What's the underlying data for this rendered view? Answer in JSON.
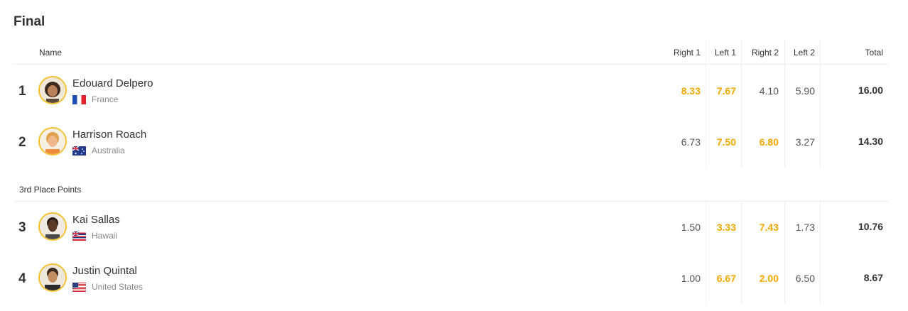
{
  "heat": {
    "title": "Final"
  },
  "columns": {
    "name": "Name",
    "right1": "Right 1",
    "left1": "Left 1",
    "right2": "Right 2",
    "left2": "Left 2",
    "total": "Total"
  },
  "section_label": "3rd Place Points",
  "highlight_color": "#f5a800",
  "surfers": [
    {
      "rank": "1",
      "name": "Edouard Delpero",
      "country": "France",
      "flag": "france-flag",
      "scores": [
        "8.33",
        "7.67",
        "4.10",
        "5.90"
      ],
      "highlighted": [
        true,
        true,
        false,
        false
      ],
      "total": "16.00"
    },
    {
      "rank": "2",
      "name": "Harrison Roach",
      "country": "Australia",
      "flag": "australia-flag",
      "scores": [
        "6.73",
        "7.50",
        "6.80",
        "3.27"
      ],
      "highlighted": [
        false,
        true,
        true,
        false
      ],
      "total": "14.30"
    },
    {
      "rank": "3",
      "name": "Kai Sallas",
      "country": "Hawaii",
      "flag": "hawaii-flag",
      "scores": [
        "1.50",
        "3.33",
        "7.43",
        "1.73"
      ],
      "highlighted": [
        false,
        true,
        true,
        false
      ],
      "total": "10.76"
    },
    {
      "rank": "4",
      "name": "Justin Quintal",
      "country": "United States",
      "flag": "usa-flag",
      "scores": [
        "1.00",
        "6.67",
        "2.00",
        "6.50"
      ],
      "highlighted": [
        false,
        true,
        true,
        false
      ],
      "total": "8.67"
    }
  ]
}
